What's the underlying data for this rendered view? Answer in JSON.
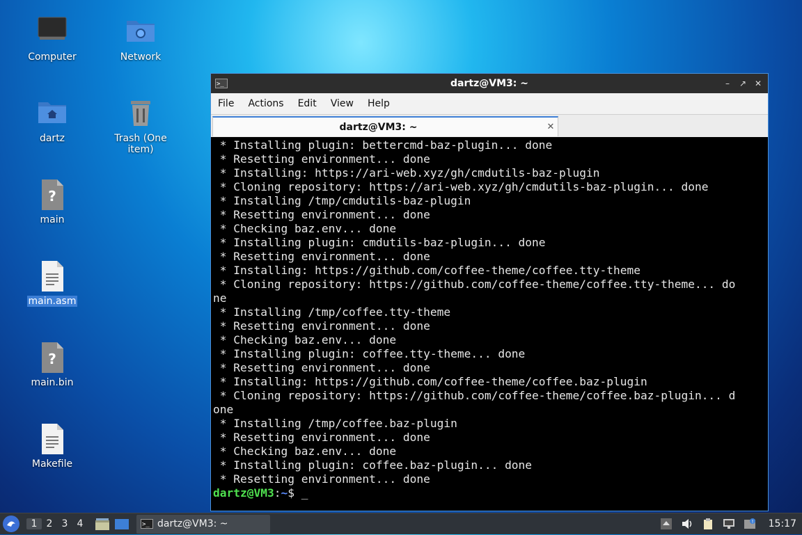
{
  "desktop": {
    "icons": [
      {
        "label": "Computer"
      },
      {
        "label": "Network"
      },
      {
        "label": "dartz"
      },
      {
        "label": "Trash (One item)"
      },
      {
        "label": "main"
      },
      {
        "label": "main.asm"
      },
      {
        "label": "main.bin"
      },
      {
        "label": "Makefile"
      }
    ]
  },
  "window": {
    "title": "dartz@VM3: ~",
    "menu": [
      "File",
      "Actions",
      "Edit",
      "View",
      "Help"
    ],
    "tab_label": "dartz@VM3: ~",
    "terminal_lines": [
      " * Installing plugin: bettercmd-baz-plugin... done",
      " * Resetting environment... done",
      " * Installing: https://ari-web.xyz/gh/cmdutils-baz-plugin",
      " * Cloning repository: https://ari-web.xyz/gh/cmdutils-baz-plugin... done",
      " * Installing /tmp/cmdutils-baz-plugin",
      " * Resetting environment... done",
      " * Checking baz.env... done",
      " * Installing plugin: cmdutils-baz-plugin... done",
      " * Resetting environment... done",
      " * Installing: https://github.com/coffee-theme/coffee.tty-theme",
      " * Cloning repository: https://github.com/coffee-theme/coffee.tty-theme... do",
      "ne",
      " * Installing /tmp/coffee.tty-theme",
      " * Resetting environment... done",
      " * Checking baz.env... done",
      " * Installing plugin: coffee.tty-theme... done",
      " * Resetting environment... done",
      " * Installing: https://github.com/coffee-theme/coffee.baz-plugin",
      " * Cloning repository: https://github.com/coffee-theme/coffee.baz-plugin... d",
      "one",
      " * Installing /tmp/coffee.baz-plugin",
      " * Resetting environment... done",
      " * Checking baz.env... done",
      " * Installing plugin: coffee.baz-plugin... done",
      " * Resetting environment... done"
    ],
    "prompt": {
      "user_host": "dartz@VM3",
      "sep": ":",
      "path": "~",
      "symbol": "$ ",
      "cursor": "_"
    }
  },
  "taskbar": {
    "workspaces": [
      "1",
      "2",
      "3",
      "4"
    ],
    "active_workspace": "1",
    "task_label": "dartz@VM3: ~",
    "clock": "15:17"
  },
  "colors": {
    "prompt_user": "#4fe04f",
    "prompt_path": "#5b8cff",
    "accent": "#3d7fd6"
  }
}
